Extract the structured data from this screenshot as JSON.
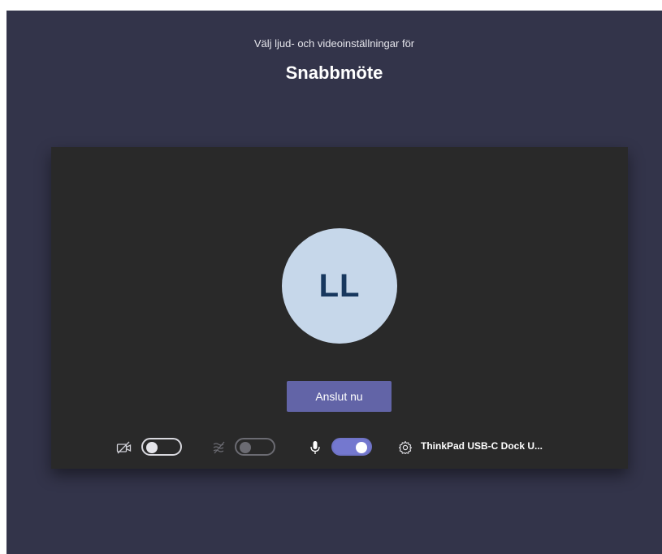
{
  "header": {
    "subtitle": "Välj ljud- och videoinställningar för",
    "meeting_title": "Snabbmöte"
  },
  "preview": {
    "avatar_initials": "LL",
    "join_button_label": "Anslut nu"
  },
  "controls": {
    "camera_toggle": {
      "icon": "camera-off-icon",
      "state": "off"
    },
    "background_toggle": {
      "icon": "background-blur-icon",
      "state": "disabled"
    },
    "microphone_toggle": {
      "icon": "microphone-icon",
      "state": "on"
    },
    "device_settings": {
      "icon": "gear-icon",
      "label": "ThinkPad USB-C Dock U..."
    }
  },
  "colors": {
    "screen_background": "#33344a",
    "preview_background": "#292929",
    "avatar_background": "#c6d7ea",
    "avatar_text": "#17375e",
    "accent": "#6264a7",
    "toggle_on": "#7478cf"
  }
}
